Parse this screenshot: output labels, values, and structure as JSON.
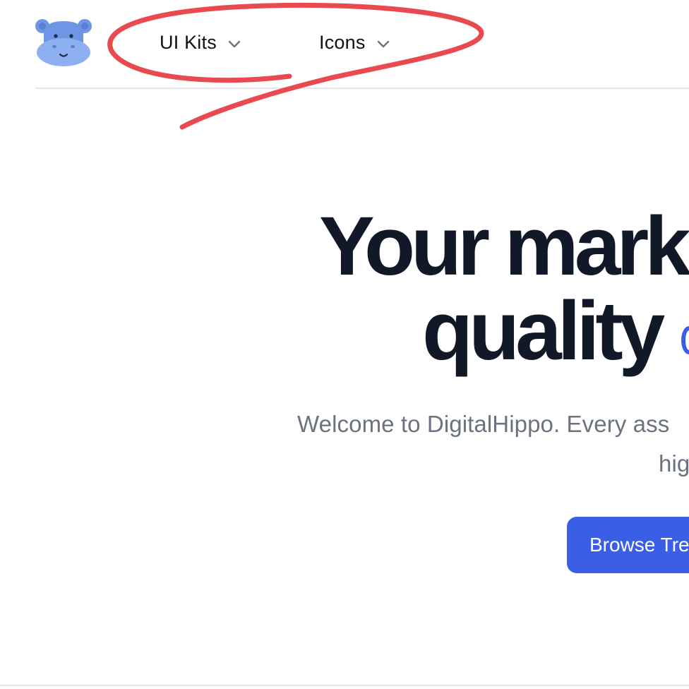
{
  "brand": {
    "logo_icon": "hippo-face-icon",
    "logo_color": "#6f96e6"
  },
  "nav": {
    "items": [
      {
        "label": "UI Kits",
        "icon": "chevron-down-icon"
      },
      {
        "label": "Icons",
        "icon": "chevron-down-icon"
      }
    ]
  },
  "annotation": {
    "color": "#e84a4f",
    "shape": "hand-drawn-loop"
  },
  "hero": {
    "title_line_1": "Your mark",
    "title_line_2": "quality",
    "subtitle_line_1": "Welcome to DigitalHippo. Every ass",
    "subtitle_line_2": "hig",
    "cta_label": "Browse Tre"
  },
  "colors": {
    "accent": "#3b5ee6",
    "heading": "#111827",
    "muted_text": "#6b7280",
    "divider": "#e6e7eb"
  }
}
